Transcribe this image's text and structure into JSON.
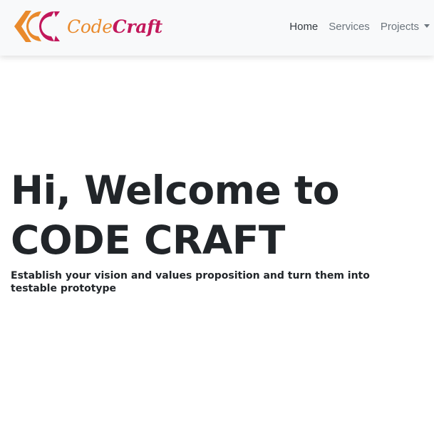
{
  "navbar": {
    "brand": {
      "logo_icon": "codecraft-cc-logo-icon",
      "name_part1": "Code",
      "name_part2": "Craft",
      "colors": {
        "orange": "#e98a2c",
        "crimson": "#c2185b"
      }
    },
    "links": [
      {
        "label": "Home",
        "active": true
      },
      {
        "label": "Services",
        "active": false
      },
      {
        "label": "Projects",
        "active": false,
        "dropdown": true
      }
    ]
  },
  "hero": {
    "line1": "Hi, Welcome to",
    "line2": "CODE CRAFT",
    "tagline": "Establish your vision and values proposition and turn them into testable prototype"
  }
}
